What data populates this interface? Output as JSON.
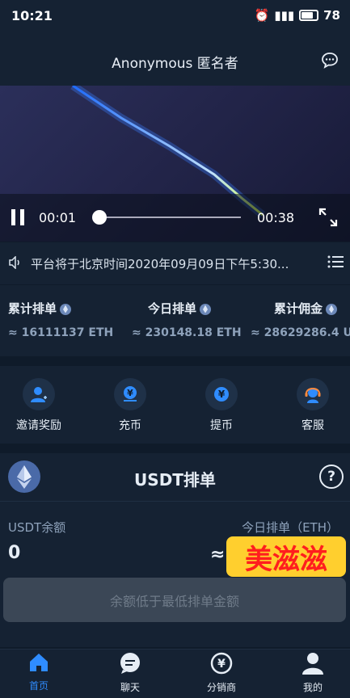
{
  "status_bar": {
    "time": "10:21",
    "battery": "78"
  },
  "header": {
    "title": "Anonymous 匿名者"
  },
  "video": {
    "current_time": "00:01",
    "duration": "00:38",
    "progress": 0.0
  },
  "notice": {
    "text": "平台将于北京时间2020年09月09日下午5:30..."
  },
  "stats": [
    {
      "label": "累计排单",
      "value": "≈ 16111137 ETH"
    },
    {
      "label": "今日排单",
      "value": "≈ 230148.18 ETH"
    },
    {
      "label": "累计佣金",
      "value": "≈ 28629286.4 U"
    }
  ],
  "menu": [
    {
      "label": "邀请奖励",
      "icon": "invite-user-icon"
    },
    {
      "label": "充币",
      "icon": "deposit-icon"
    },
    {
      "label": "提币",
      "icon": "withdraw-icon"
    },
    {
      "label": "客服",
      "icon": "customer-service-icon"
    }
  ],
  "usdt": {
    "title": "USDT排单",
    "balance_label": "USDT余额",
    "balance_value": "0",
    "today_label": "今日排单（ETH）",
    "today_value_prefix": "≈",
    "sticker": "美滋滋",
    "button_label": "余额低于最低排单金额"
  },
  "tabs": [
    {
      "label": "首页",
      "icon": "home-icon",
      "active": true
    },
    {
      "label": "聊天",
      "icon": "chat-bubble-icon",
      "active": false
    },
    {
      "label": "分销商",
      "icon": "yen-coin-icon",
      "active": false
    },
    {
      "label": "我的",
      "icon": "user-icon",
      "active": false
    }
  ],
  "colors": {
    "accent": "#2f8cff",
    "background": "#0f1b2a",
    "panel": "#152233",
    "sticker_red": "#ff1e1e",
    "sticker_yellow": "#ffcf2e"
  }
}
